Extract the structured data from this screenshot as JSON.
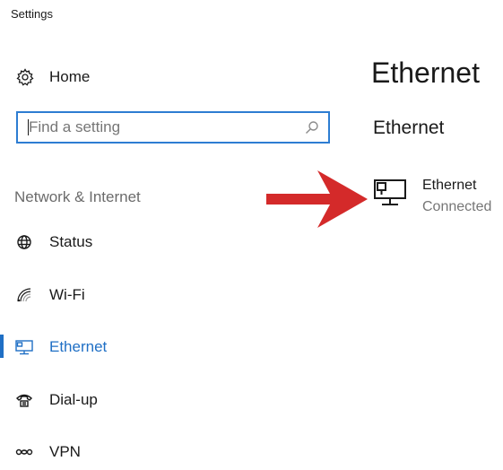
{
  "window": {
    "title": "Settings"
  },
  "sidebar": {
    "home": {
      "label": "Home",
      "icon": "gear-icon"
    },
    "search": {
      "placeholder": "Find a setting",
      "icon": "search-icon"
    },
    "section_label": "Network & Internet",
    "items": [
      {
        "label": "Status",
        "icon": "globe-icon",
        "active": false
      },
      {
        "label": "Wi-Fi",
        "icon": "wifi-icon",
        "active": false
      },
      {
        "label": "Ethernet",
        "icon": "ethernet-icon",
        "active": true
      },
      {
        "label": "Dial-up",
        "icon": "dialup-icon",
        "active": false
      },
      {
        "label": "VPN",
        "icon": "vpn-icon",
        "active": false
      }
    ]
  },
  "main": {
    "title": "Ethernet",
    "subtitle": "Ethernet",
    "connection": {
      "name": "Ethernet",
      "status": "Connected",
      "icon": "network-monitor-icon"
    }
  },
  "annotation": {
    "icon": "red-arrow-icon",
    "color": "#d42a2a"
  },
  "colors": {
    "accent": "#1f6fc5",
    "search_border": "#2d7dd2",
    "muted_text": "#767676"
  }
}
